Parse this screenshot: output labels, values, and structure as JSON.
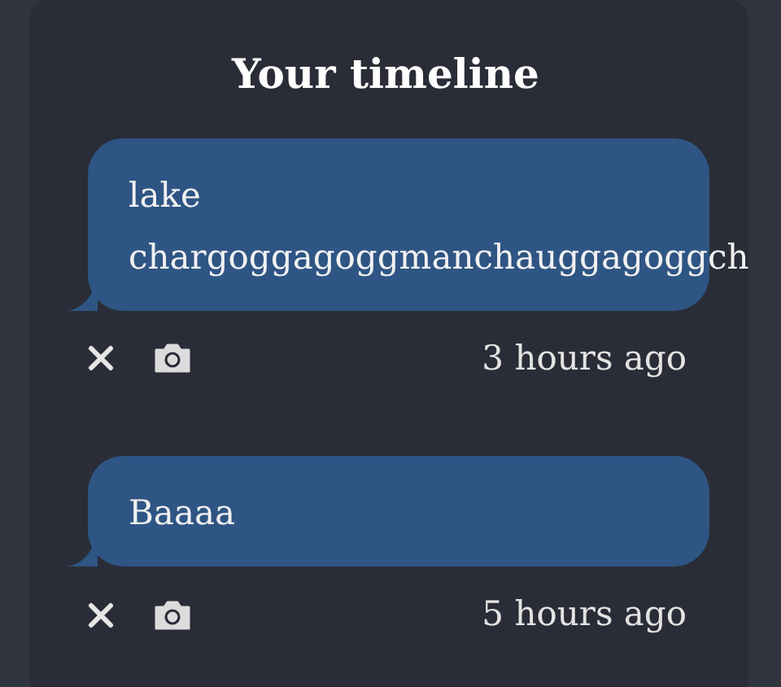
{
  "title": "Your timeline",
  "posts": [
    {
      "text": "lake chargoggagoggmanchauggagoggch",
      "time": "3 hours ago"
    },
    {
      "text": "Baaaa",
      "time": "5 hours ago"
    }
  ]
}
